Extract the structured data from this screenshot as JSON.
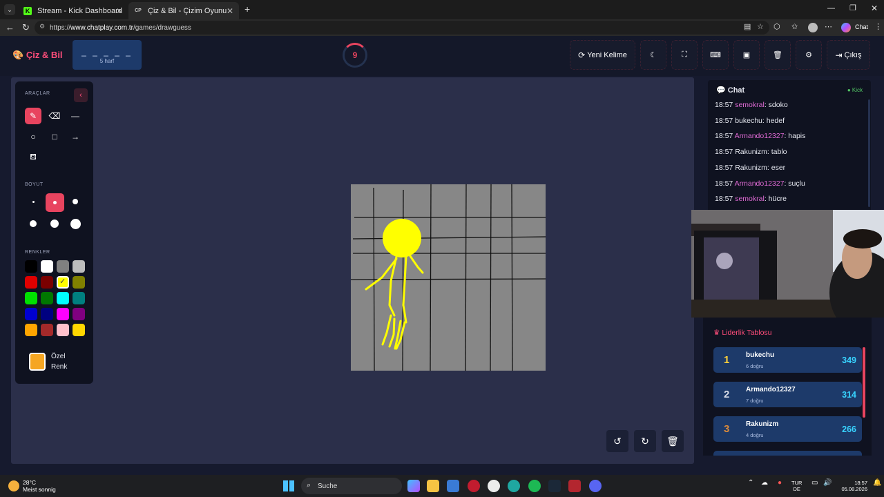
{
  "browser": {
    "tabs": [
      {
        "title": "Stream - Kick Dashboard",
        "icon": "K"
      },
      {
        "title": "Çiz & Bil - Çizim Oyunu",
        "icon": "CP"
      }
    ],
    "url_prefix": "https://",
    "url_host": "www.chatplay.com.tr",
    "url_path": "/games/drawguess",
    "profile_label": "Chat"
  },
  "header": {
    "logo": "Çiz & Bil",
    "word_mask": "_ _ _ _ _",
    "word_hint": "5 harf",
    "timer": "9",
    "new_word": "Yeni Kelime",
    "exit": "Çıkış"
  },
  "tools": {
    "title": "ARAÇLAR",
    "size_title": "BOYUT",
    "colors_title": "RENKLER",
    "custom_line1": "Özel",
    "custom_line2": "Renk",
    "colors": [
      "#000000",
      "#ffffff",
      "#808080",
      "#bdbdbd",
      "#e00000",
      "#7a0000",
      "#ffff00",
      "#808000",
      "#00e000",
      "#007800",
      "#00ffff",
      "#008080",
      "#0000d0",
      "#000080",
      "#ff00ff",
      "#800080",
      "#ffa500",
      "#a52a2a",
      "#ffc0cb",
      "#ffd700"
    ],
    "active_tool": "brush",
    "selected_size_index": 1,
    "selected_color": "#ffff00",
    "custom_color": "#f5a623"
  },
  "chat": {
    "title": "Chat",
    "source": "Kick",
    "messages": [
      {
        "time": "18:57",
        "user": "semokral",
        "text": ": sdoko",
        "highlight": true
      },
      {
        "time": "18:57",
        "user": "bukechu",
        "text": ": hedef",
        "highlight": false
      },
      {
        "time": "18:57",
        "user": "Armando12327",
        "text": ": hapis",
        "highlight": true
      },
      {
        "time": "18:57",
        "user": "Rakunizm",
        "text": ": tablo",
        "highlight": false
      },
      {
        "time": "18:57",
        "user": "Rakunizm",
        "text": ": eser",
        "highlight": false
      },
      {
        "time": "18:57",
        "user": "Armando12327",
        "text": ": suçlu",
        "highlight": true
      },
      {
        "time": "18:57",
        "user": "semokral",
        "text": ": hücre",
        "highlight": true
      }
    ]
  },
  "leaderboard": {
    "title": "Liderlik Tablosu",
    "rows": [
      {
        "rank": "1",
        "name": "bukechu",
        "sub": "6 doğru",
        "score": "349"
      },
      {
        "rank": "2",
        "name": "Armando12327",
        "sub": "7 doğru",
        "score": "314"
      },
      {
        "rank": "3",
        "name": "Rakunizm",
        "sub": "4 doğru",
        "score": "266"
      }
    ]
  },
  "taskbar": {
    "temp": "28°C",
    "weather": "Meist sonnig",
    "search": "Suche",
    "lang1": "TUR",
    "lang2": "DE",
    "time": "18:57",
    "date": "05.08.2026"
  },
  "colors": {
    "accent": "#e8445f",
    "panel": "#0f1220",
    "canvas_bg": "#2b2f4a",
    "leader_row": "#1d3a6a",
    "score": "#38d3ff"
  }
}
